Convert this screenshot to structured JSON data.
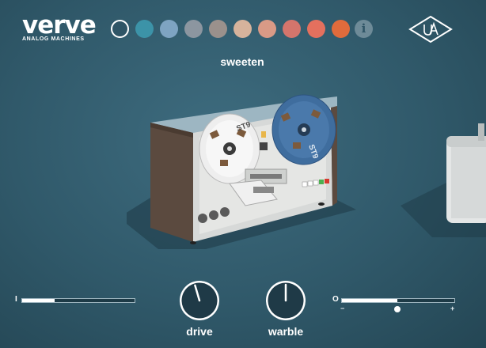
{
  "header": {
    "logo_word": "verve",
    "logo_sub": "ANALOG MACHINES",
    "color_swatches": [
      "#2f5566",
      "#3c93a8",
      "#7ea4c2",
      "#8c96a0",
      "#9b918c",
      "#d6b39c",
      "#d99a86",
      "#d4756c",
      "#e4705e",
      "#e06b3c"
    ],
    "selected_swatch": 0,
    "info_label": "i"
  },
  "preset": {
    "name": "sweeten"
  },
  "machine": {
    "left_reel_label": "ST9",
    "right_reel_label": "ST9"
  },
  "controls": {
    "input": {
      "label": "I",
      "level": 0.29
    },
    "drive": {
      "label": "drive",
      "value": 0.44
    },
    "warble": {
      "label": "warble",
      "value": 0.5
    },
    "output": {
      "label": "O",
      "minus": "−",
      "plus": "+",
      "level": 0.49,
      "value": 0.49
    }
  }
}
